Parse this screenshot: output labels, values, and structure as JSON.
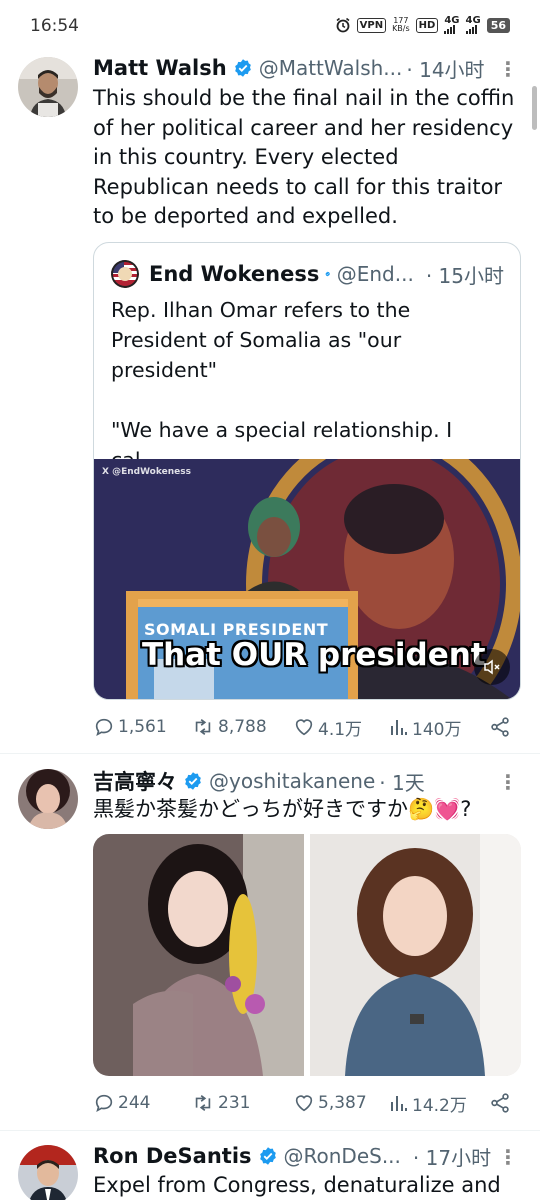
{
  "status_bar": {
    "time": "16:54",
    "vpn": "VPN",
    "speed_value": "177",
    "speed_unit": "KB/s",
    "hd": "HD",
    "net1": "4G",
    "net2": "4G",
    "battery": "56"
  },
  "tweets": [
    {
      "name": "Matt Walsh",
      "handle": "@MattWalsh...",
      "time": "· 14小时",
      "text": "This should be the final nail in the coffin of her political career and her residency in this country. Every elected  Republican needs to call for this traitor to be deported and expelled.",
      "quote": {
        "name": "End Wokeness",
        "handle": "@End...",
        "time": "· 15小时",
        "text_line1": "Rep. Ilhan Omar refers to the President of Somalia as \"our president\"",
        "text_line2": "\"We have a special relationship. I cal...",
        "media": {
          "watermark": "X @EndWokeness",
          "podium_text": "SOMALI PRESIDENT",
          "caption": "That OUR president"
        }
      },
      "stats": {
        "replies": "1,561",
        "retweets": "8,788",
        "likes": "4.1万",
        "views": "140万"
      }
    },
    {
      "name": "吉高寧々",
      "handle": "@yoshitakanene",
      "time": "· 1天",
      "text": "黒髪か茶髪かどっちが好きですか🤔💓?",
      "stats": {
        "replies": "244",
        "retweets": "231",
        "likes": "5,387",
        "views": "14.2万"
      }
    },
    {
      "name": "Ron DeSantis",
      "handle": "@RonDeS...",
      "time": "· 17小时",
      "text": "Expel from Congress, denaturalize and"
    }
  ],
  "colors": {
    "verified": "#1d9bf0",
    "muted_text": "#536471",
    "border": "#cfd9de"
  }
}
